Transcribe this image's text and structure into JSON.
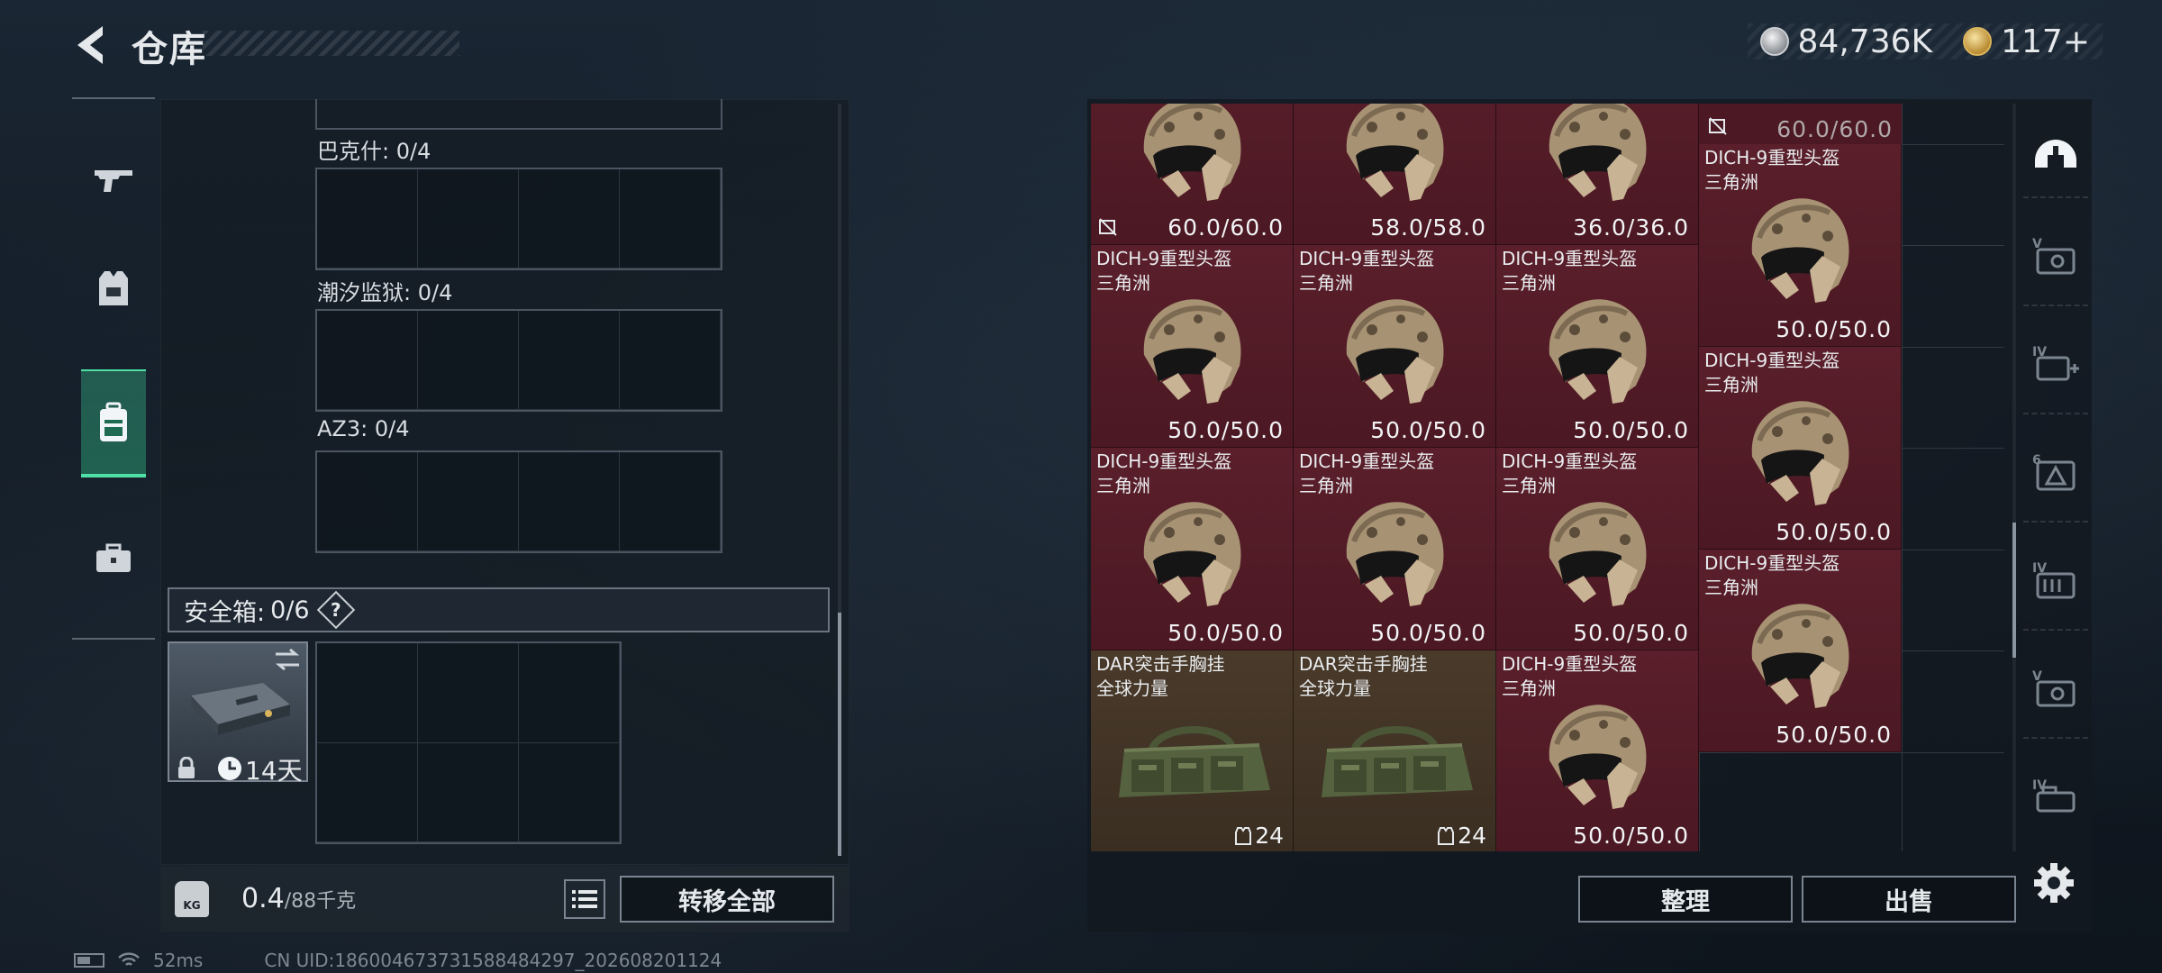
{
  "header": {
    "title": "仓库",
    "currency_silver": "84,736K",
    "currency_gold": "117+"
  },
  "left_nav": [
    {
      "id": "weapons",
      "icon": "gun-icon",
      "active": false
    },
    {
      "id": "armor",
      "icon": "vest-icon",
      "active": false
    },
    {
      "id": "backpack",
      "icon": "backpack-icon",
      "active": true
    },
    {
      "id": "case",
      "icon": "briefcase-icon",
      "active": false
    }
  ],
  "storage": {
    "sections": [
      {
        "label": "巴克什: 0/4"
      },
      {
        "label": "潮汐监狱: 0/4"
      },
      {
        "label": "AZ3: 0/4"
      }
    ],
    "safe_box": {
      "label": "安全箱:",
      "count": "0/6",
      "help": "?",
      "timer": "14天"
    },
    "weight": {
      "current": "0.4",
      "max": "/88千克",
      "icon_label": "KG"
    },
    "transfer_all": "转移全部"
  },
  "status_bar": {
    "ping": "52ms",
    "uid": "CN UID:1860046737315884842​97_202608201124"
  },
  "warehouse": {
    "items": [
      {
        "type": "helmet",
        "color": "red",
        "name": "",
        "region": "",
        "durability": "60.0/60.0",
        "col": 0,
        "row": -1,
        "no_trade": true
      },
      {
        "type": "helmet",
        "color": "red",
        "name": "",
        "region": "",
        "durability": "58.0/58.0",
        "col": 1,
        "row": -1,
        "no_trade": false
      },
      {
        "type": "helmet",
        "color": "red",
        "name": "",
        "region": "",
        "durability": "36.0/36.0",
        "col": 2,
        "row": -1,
        "no_trade": false
      },
      {
        "type": "helmet",
        "color": "red",
        "name": "DICH-9重型头盔",
        "region": "三角洲",
        "durability": "50.0/50.0",
        "col": 3,
        "row": 0,
        "no_trade": false,
        "top_durability": "60.0/60.0"
      },
      {
        "type": "helmet",
        "color": "red",
        "name": "DICH-9重型头盔",
        "region": "三角洲",
        "durability": "50.0/50.0",
        "col": 0,
        "row": 1,
        "no_trade": false
      },
      {
        "type": "helmet",
        "color": "red",
        "name": "DICH-9重型头盔",
        "region": "三角洲",
        "durability": "50.0/50.0",
        "col": 1,
        "row": 1,
        "no_trade": false
      },
      {
        "type": "helmet",
        "color": "red",
        "name": "DICH-9重型头盔",
        "region": "三角洲",
        "durability": "50.0/50.0",
        "col": 2,
        "row": 1,
        "no_trade": false
      },
      {
        "type": "helmet",
        "color": "red",
        "name": "DICH-9重型头盔",
        "region": "三角洲",
        "durability": "50.0/50.0",
        "col": 3,
        "row": 2,
        "no_trade": false
      },
      {
        "type": "helmet",
        "color": "red",
        "name": "DICH-9重型头盔",
        "region": "三角洲",
        "durability": "50.0/50.0",
        "col": 0,
        "row": 3,
        "no_trade": false
      },
      {
        "type": "helmet",
        "color": "red",
        "name": "DICH-9重型头盔",
        "region": "三角洲",
        "durability": "50.0/50.0",
        "col": 1,
        "row": 3,
        "no_trade": false
      },
      {
        "type": "helmet",
        "color": "red",
        "name": "DICH-9重型头盔",
        "region": "三角洲",
        "durability": "50.0/50.0",
        "col": 2,
        "row": 3,
        "no_trade": false
      },
      {
        "type": "helmet",
        "color": "red",
        "name": "DICH-9重型头盔",
        "region": "三角洲",
        "durability": "50.0/50.0",
        "col": 3,
        "row": 4,
        "no_trade": false
      },
      {
        "type": "bag",
        "color": "brown",
        "name": "DAR突击手胸挂",
        "region": "全球力量",
        "quantity": "24",
        "col": 0,
        "row": 5,
        "no_trade": false
      },
      {
        "type": "bag",
        "color": "brown",
        "name": "DAR突击手胸挂",
        "region": "全球力量",
        "quantity": "24",
        "col": 1,
        "row": 5,
        "no_trade": false
      },
      {
        "type": "helmet",
        "color": "red",
        "name": "DICH-9重型头盔",
        "region": "三角洲",
        "durability": "50.0/50.0",
        "col": 2,
        "row": 5,
        "no_trade": false
      }
    ],
    "sort_button": "整理",
    "sell_button": "出售"
  },
  "categories": [
    {
      "icon": "helmet-category-icon",
      "label": ""
    },
    {
      "icon": "armor-v-icon",
      "label": "V"
    },
    {
      "icon": "medkit-iv-icon",
      "label": "IV"
    },
    {
      "icon": "item-6-icon",
      "label": "6"
    },
    {
      "icon": "ammo-iv-icon",
      "label": "IV"
    },
    {
      "icon": "armor-v2-icon",
      "label": "V"
    },
    {
      "icon": "gear-iv-icon",
      "label": "IV"
    }
  ],
  "colors": {
    "accent_green": "#4ee0a6",
    "item_red": "#5a1f2a",
    "item_brown": "#4a3a2a"
  }
}
